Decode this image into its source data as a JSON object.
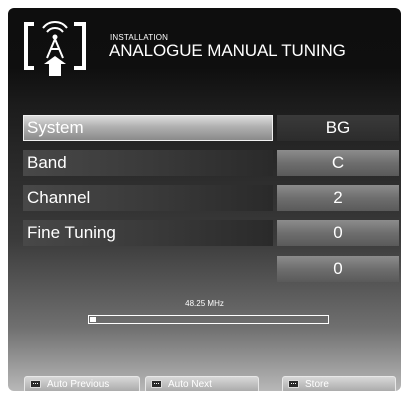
{
  "header": {
    "subtitle": "INSTALLATION",
    "title": "ANALOGUE MANUAL TUNING",
    "logo_icon": "antenna-installation-icon"
  },
  "rows": [
    {
      "label": "System",
      "value": "BG",
      "selected": true
    },
    {
      "label": "Band",
      "value": "C",
      "selected": false
    },
    {
      "label": "Channel",
      "value": "2",
      "selected": false
    },
    {
      "label": "Fine Tuning",
      "value": "0",
      "selected": false
    },
    {
      "label": "",
      "value": "0",
      "selected": false
    }
  ],
  "frequency": {
    "label": "48.25 MHz",
    "progress_fraction": 0.025
  },
  "buttons": {
    "auto_previous": "Auto Previous",
    "auto_next": "Auto Next",
    "store": "Store"
  },
  "colors": {
    "text": "#ffffff",
    "background_top": "#0e0e0e",
    "background_bottom": "#b8b8b8"
  }
}
